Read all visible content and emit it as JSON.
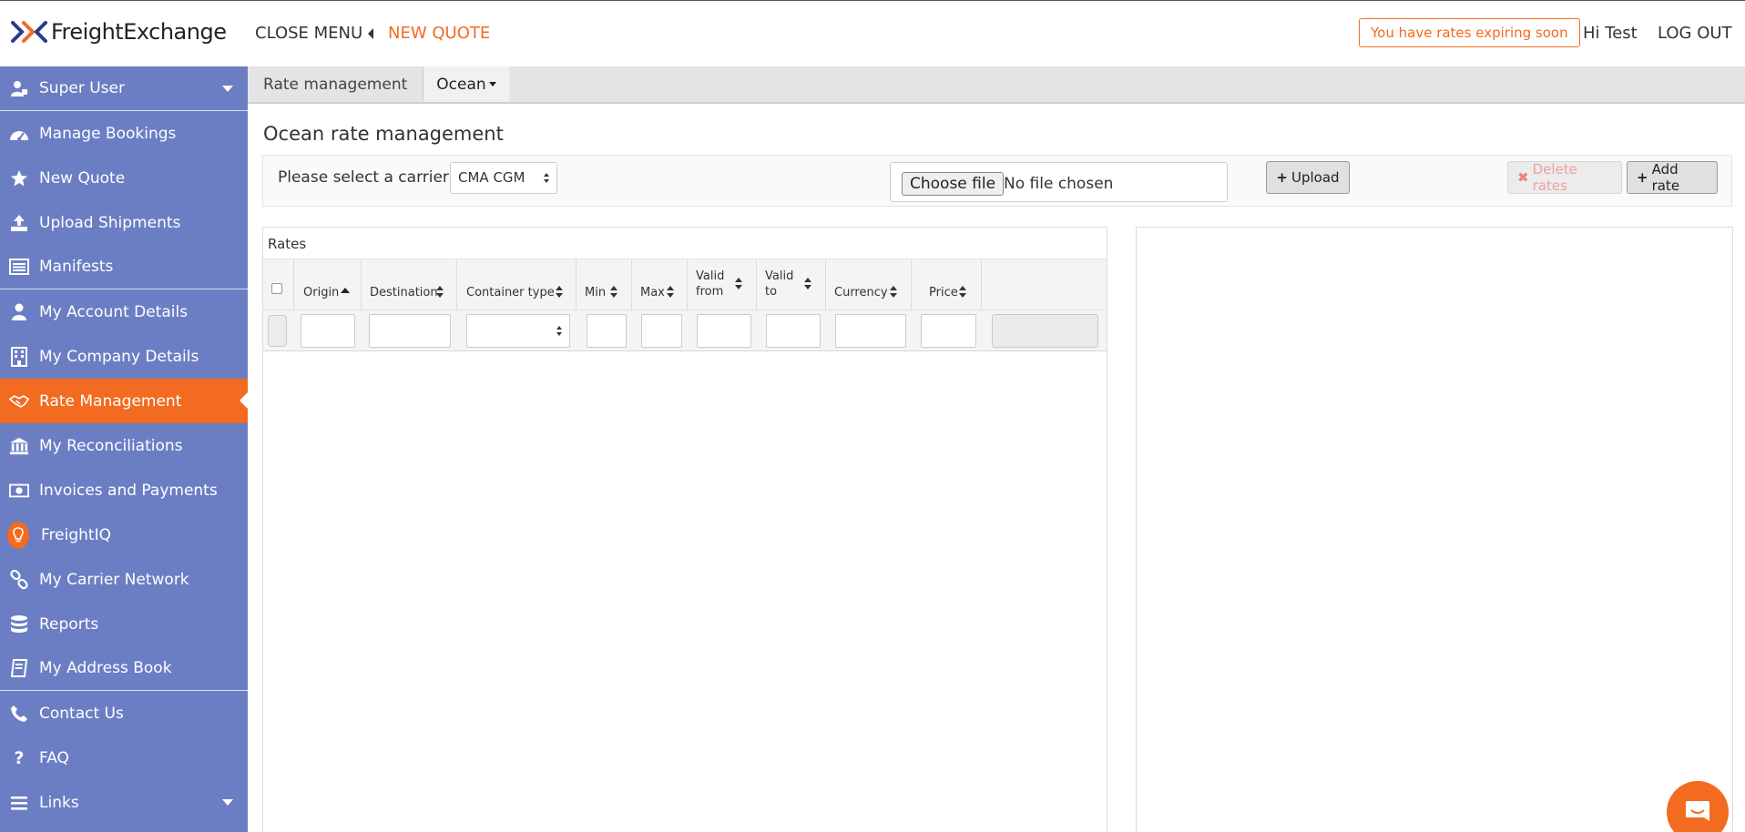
{
  "header": {
    "brand": "FreightExchange",
    "close_menu": "CLOSE MENU",
    "new_quote": "NEW QUOTE",
    "alert": "You have rates expiring soon",
    "greeting": "Hi Test",
    "logout": "LOG OUT"
  },
  "sidebar": {
    "items": [
      {
        "label": "Super User",
        "icon": "user-group-icon"
      },
      {
        "label": "Manage Bookings",
        "icon": "dashboard-gauge-icon"
      },
      {
        "label": "New Quote",
        "icon": "star-icon"
      },
      {
        "label": "Upload Shipments",
        "icon": "upload-icon"
      },
      {
        "label": "Manifests",
        "icon": "list-icon"
      },
      {
        "label": "My Account Details",
        "icon": "user-icon"
      },
      {
        "label": "My Company Details",
        "icon": "building-icon"
      },
      {
        "label": "Rate Management",
        "icon": "handshake-icon"
      },
      {
        "label": "My Reconciliations",
        "icon": "bank-icon"
      },
      {
        "label": "Invoices and Payments",
        "icon": "money-icon"
      },
      {
        "label": "FreightIQ",
        "icon": "lightbulb-icon"
      },
      {
        "label": "My Carrier Network",
        "icon": "link-icon"
      },
      {
        "label": "Reports",
        "icon": "database-icon"
      },
      {
        "label": "My Address Book",
        "icon": "book-icon"
      },
      {
        "label": "Contact Us",
        "icon": "phone-icon"
      },
      {
        "label": "FAQ",
        "icon": "question-icon"
      },
      {
        "label": "Links",
        "icon": "menu-icon"
      }
    ],
    "active_index": 7
  },
  "breadcrumb": {
    "rate_management": "Rate management",
    "mode": "Ocean"
  },
  "main": {
    "title": "Ocean rate management",
    "carrier_label": "Please select a carrier :",
    "carrier_value": "CMA CGM",
    "file_button": "Choose file",
    "file_status": "No file chosen",
    "upload": "Upload",
    "delete_rates": "Delete rates",
    "add_rate": "Add rate"
  },
  "rates": {
    "title": "Rates",
    "columns": {
      "origin": "Origin",
      "destination": "Destination",
      "container_type": "Container type",
      "min": "Min",
      "max": "Max",
      "valid_from_1": "Valid",
      "valid_from_2": "from",
      "valid_to_1": "Valid",
      "valid_to_2": "to",
      "currency": "Currency",
      "price": "Price"
    }
  },
  "colors": {
    "sidebar": "#6b7ec4",
    "accent": "#f26b21",
    "breadcrumb": "#e4e4e6"
  }
}
